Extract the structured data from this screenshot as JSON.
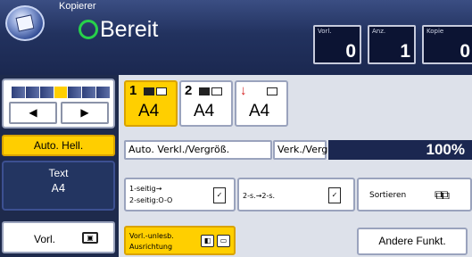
{
  "header": {
    "app_title": "Kopierer",
    "status": "Bereit",
    "counters": [
      {
        "label": "Vorl.",
        "value": "0"
      },
      {
        "label": "Anz.",
        "value": "1"
      },
      {
        "label": "Kopie",
        "value": "0"
      }
    ]
  },
  "left": {
    "arrow_left": "◀",
    "arrow_right": "▶",
    "auto_hell": "Auto. Hell.",
    "mode_title": "Text",
    "mode_size": "A4",
    "vorl_label": "Vorl.",
    "vorl_icon": "▣"
  },
  "trays": [
    {
      "number": "1",
      "size": "A4",
      "selected": true
    },
    {
      "number": "2",
      "size": "A4",
      "selected": false
    },
    {
      "number": "↓",
      "size": "A4",
      "selected": false
    }
  ],
  "zoom": {
    "auto_label": "Auto. Verkl./Vergröß.",
    "vv_label": "Verk./Verg.",
    "value": "100%"
  },
  "options": {
    "duplex1_line1": "1-seitig→",
    "duplex1_line2": "2-seitig:O-O",
    "duplex2_label": "2-s.→2-s.",
    "sort_label": "Sortieren",
    "orient_line1": "Vorl.-unlesb.",
    "orient_line2": "Ausrichtung",
    "other_functions": "Andere Funkt."
  }
}
